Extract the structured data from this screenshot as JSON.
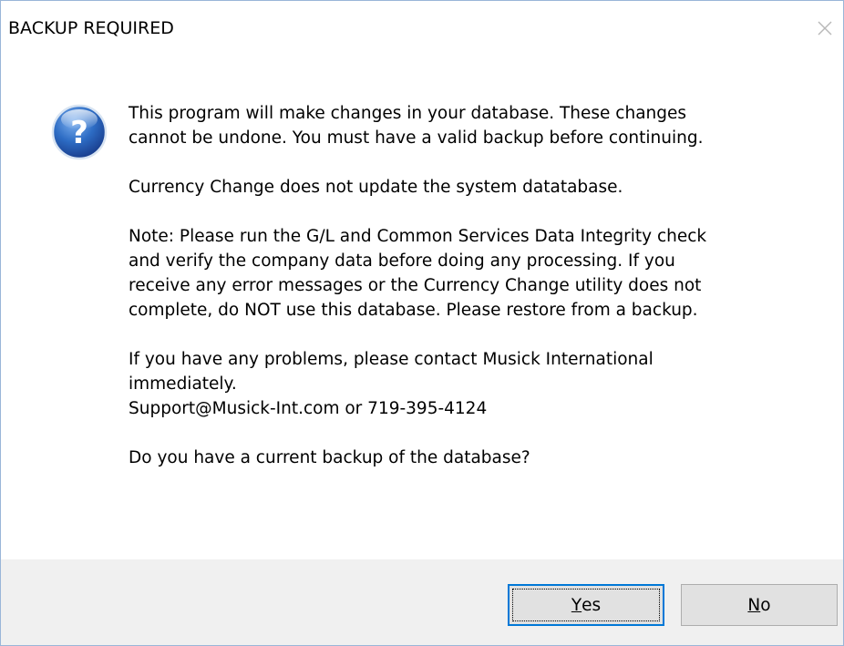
{
  "window": {
    "title": "BACKUP REQUIRED",
    "close_icon": "close-icon"
  },
  "message": {
    "icon": "question-icon",
    "paragraphs": [
      "This program will make changes in your database.  These changes\ncannot be undone. You must have a valid backup before continuing.",
      "Currency Change does not update the system datatabase.",
      "Note: Please run the G/L and Common Services Data Integrity check\nand verify the company data before doing any processing.  If you\nreceive any error messages or the Currency Change utility does not\ncomplete, do NOT use this database. Please restore from a backup.",
      "If you have any problems, please contact Musick International\nimmediately.\nSupport@Musick-Int.com or 719-395-4124",
      "Do you have a current backup of the database?"
    ]
  },
  "buttons": {
    "yes": {
      "mnemonic": "Y",
      "rest": "es"
    },
    "no": {
      "mnemonic": "N",
      "rest": "o"
    }
  },
  "colors": {
    "accent": "#0078d7",
    "footer_bg": "#f0f0f0",
    "icon_blue": "#1f5fb8"
  }
}
